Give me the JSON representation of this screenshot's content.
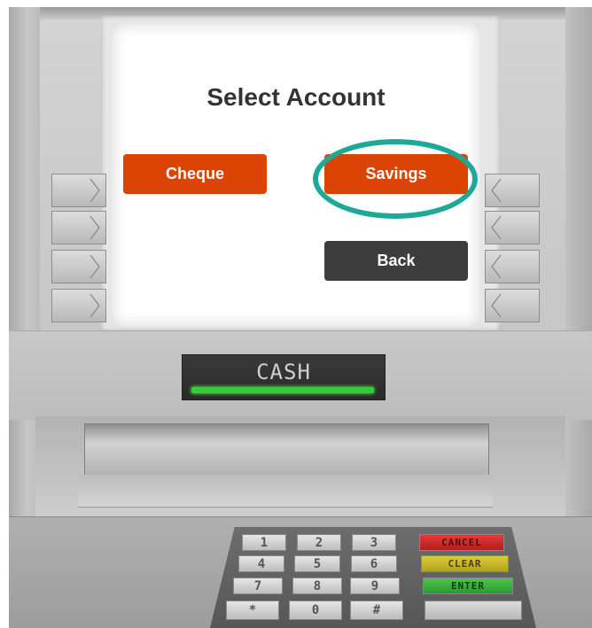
{
  "screen": {
    "title": "Select Account",
    "buttons": {
      "cheque": "Cheque",
      "savings": "Savings",
      "back": "Back"
    },
    "highlighted": "Savings"
  },
  "cash_display": {
    "label": "CASH"
  },
  "keypad": {
    "rows": [
      [
        "1",
        "2",
        "3"
      ],
      [
        "4",
        "5",
        "6"
      ],
      [
        "7",
        "8",
        "9"
      ],
      [
        "*",
        "0",
        "#"
      ]
    ],
    "functions": {
      "cancel": "CANCEL",
      "clear": "CLEAR",
      "enter": "ENTER"
    }
  },
  "colors": {
    "primary_button": "#dc4405",
    "back_button": "#3d3d3d",
    "highlight_ring": "#1ea89a",
    "cash_slot_light": "#2ecf3a",
    "cancel_key": "#d42c2c",
    "clear_key": "#cbb92a",
    "enter_key": "#3cb53c"
  },
  "icons": {
    "left_side_keys": "chevron-right-icon",
    "right_side_keys": "chevron-left-icon"
  }
}
